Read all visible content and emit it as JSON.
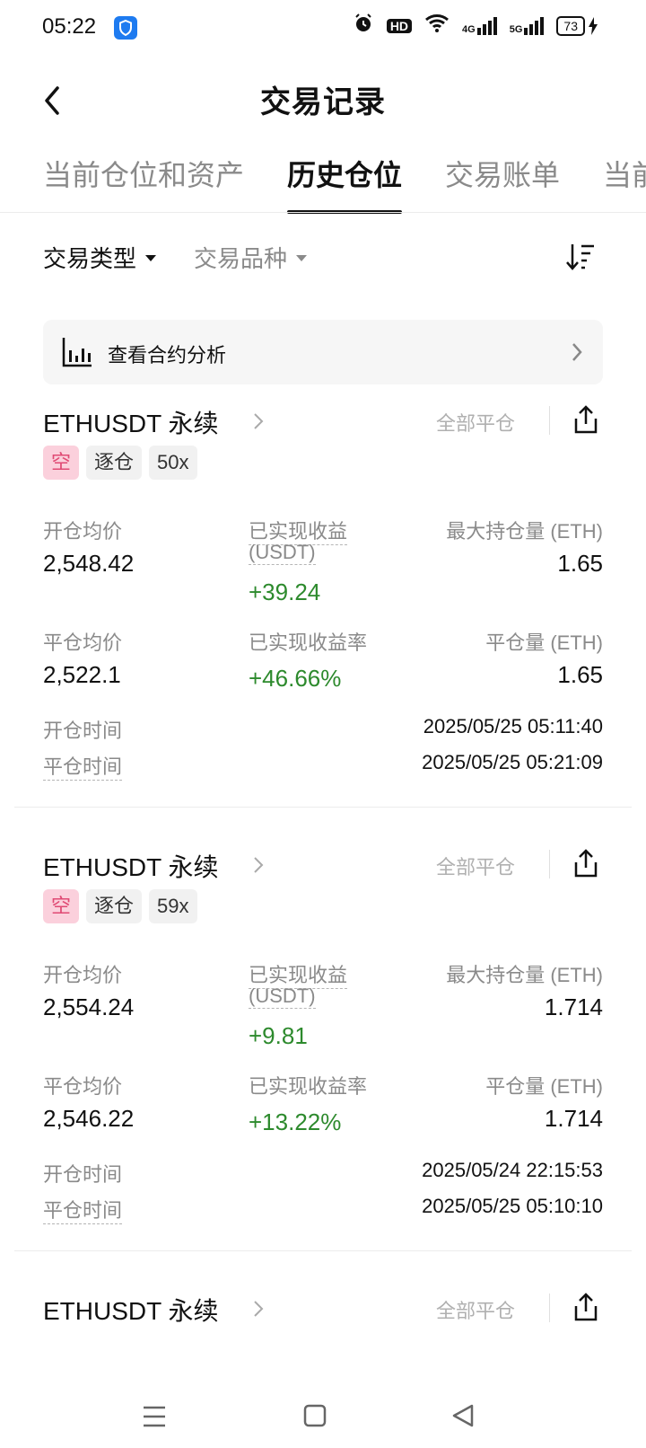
{
  "status_bar": {
    "time": "05:22",
    "icons": [
      "shield-icon",
      "alarm-icon",
      "hd-icon",
      "wifi-icon",
      "signal-4g-icon",
      "signal-5g-icon"
    ],
    "hd_label": "HD",
    "net1": "4G",
    "net2": "5G",
    "battery": "73"
  },
  "header": {
    "title": "交易记录",
    "back_icon": "chevron-left-icon"
  },
  "tabs": [
    {
      "label": "当前仓位和资产",
      "active": false
    },
    {
      "label": "历史仓位",
      "active": true
    },
    {
      "label": "交易账单",
      "active": false
    },
    {
      "label": "当前",
      "active": false
    }
  ],
  "filters": {
    "type_label": "交易类型",
    "symbol_label": "交易品种",
    "sort_icon": "sort-icon"
  },
  "banner": {
    "label": "查看合约分析",
    "icon": "bar-chart-icon"
  },
  "labels": {
    "open_avg": "开仓均价",
    "realized_pnl_1": "已实现收益",
    "realized_pnl_2": "(USDT)",
    "max_hold": "最大持仓量 (ETH)",
    "close_avg": "平仓均价",
    "realized_rate": "已实现收益率",
    "close_qty": "平仓量 (ETH)",
    "open_time": "开仓时间",
    "close_time": "平仓时间",
    "close_all": "全部平仓"
  },
  "records": [
    {
      "symbol": "ETHUSDT 永续",
      "tags": [
        "空",
        "逐仓",
        "50x"
      ],
      "open_avg": "2,548.42",
      "realized_pnl": "+39.24",
      "max_hold": "1.65",
      "close_avg": "2,522.1",
      "realized_rate": "+46.66%",
      "close_qty": "1.65",
      "open_time": "2025/05/25 05:11:40",
      "close_time": "2025/05/25 05:21:09"
    },
    {
      "symbol": "ETHUSDT 永续",
      "tags": [
        "空",
        "逐仓",
        "59x"
      ],
      "open_avg": "2,554.24",
      "realized_pnl": "+9.81",
      "max_hold": "1.714",
      "close_avg": "2,546.22",
      "realized_rate": "+13.22%",
      "close_qty": "1.714",
      "open_time": "2025/05/24 22:15:53",
      "close_time": "2025/05/25 05:10:10"
    },
    {
      "symbol": "ETHUSDT 永续"
    }
  ],
  "colors": {
    "positive": "#2d8a2d",
    "short_tag_bg": "#fbd0dc",
    "short_tag_text": "#e04a74"
  },
  "nav_bar": {
    "icons": [
      "menu-icon",
      "home-square-icon",
      "back-triangle-icon"
    ]
  }
}
